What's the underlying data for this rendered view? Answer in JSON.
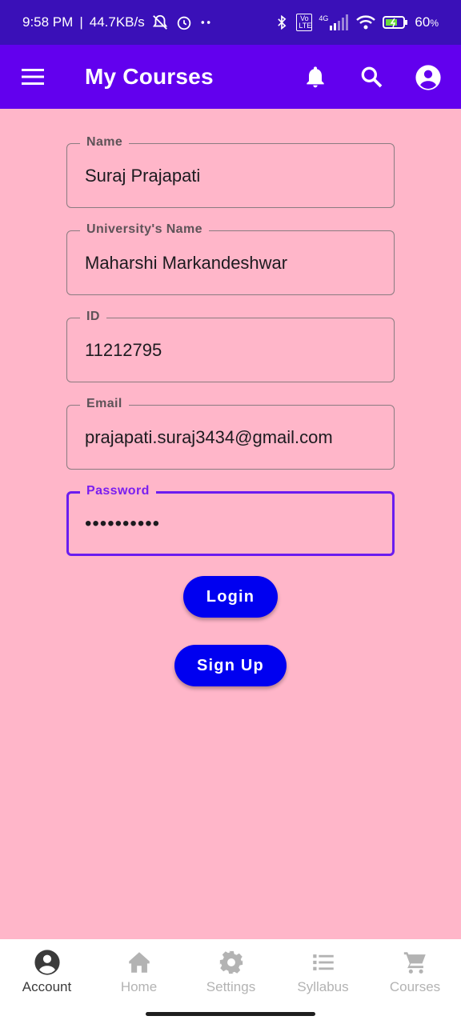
{
  "status_bar": {
    "time": "9:58 PM",
    "network_speed": "44.7KB/s",
    "battery": "60",
    "battery_unit": "%",
    "network_type": "4G",
    "volte": "Vo LTE"
  },
  "app_bar": {
    "title": "My Courses",
    "icons": [
      "menu-icon",
      "bell-icon",
      "search-icon",
      "account-circle-icon"
    ],
    "color": "#6200ee"
  },
  "form": {
    "name": {
      "label": "Name",
      "value": "Suraj Prajapati"
    },
    "university": {
      "label": "University's Name",
      "value": "Maharshi Markandeshwar"
    },
    "id": {
      "label": "ID",
      "value": "11212795"
    },
    "email": {
      "label": "Email",
      "value": "prajapati.suraj3434@gmail.com"
    },
    "password": {
      "label": "Password",
      "value": "••••••••••"
    }
  },
  "buttons": {
    "login": "Login",
    "signup": "Sign Up",
    "color": "#0000f0"
  },
  "bottom_nav": {
    "items": [
      {
        "label": "Account",
        "icon": "account-circle-icon",
        "active": true
      },
      {
        "label": "Home",
        "icon": "home-icon",
        "active": false
      },
      {
        "label": "Settings",
        "icon": "gear-icon",
        "active": false
      },
      {
        "label": "Syllabus",
        "icon": "list-icon",
        "active": false
      },
      {
        "label": "Courses",
        "icon": "cart-icon",
        "active": false
      }
    ]
  },
  "colors": {
    "background": "#ffb6c9",
    "status_bar": "#3a10b8",
    "focus": "#6a1cf0"
  }
}
